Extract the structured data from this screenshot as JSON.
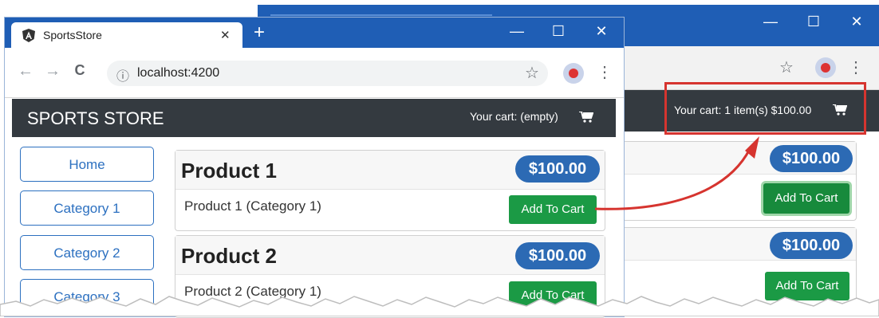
{
  "front": {
    "tab_title": "SportsStore",
    "tab_close": "✕",
    "new_tab": "+",
    "window_controls": {
      "minimize": "—",
      "maximize": "☐",
      "close": "✕"
    },
    "toolbar": {
      "url": "localhost:4200",
      "back": "←",
      "forward": "→",
      "reload": "C",
      "info": "ⓘ",
      "star": "☆",
      "menu": "⋮"
    },
    "navbar": {
      "brand": "SPORTS STORE",
      "cart": "Your cart: (empty)"
    },
    "categories": [
      "Home",
      "Category 1",
      "Category 2",
      "Category 3"
    ],
    "products": [
      {
        "title": "Product 1",
        "price": "$100.00",
        "description": "Product 1 (Category 1)",
        "button": "Add To Cart"
      },
      {
        "title": "Product 2",
        "price": "$100.00",
        "description": "Product 2 (Category 1)",
        "button": "Add To Cart"
      }
    ]
  },
  "back": {
    "window_controls": {
      "minimize": "—",
      "maximize": "☐",
      "close": "✕"
    },
    "toolbar": {
      "star": "☆",
      "menu": "⋮"
    },
    "navbar": {
      "cart": "Your cart: 1 item(s) $100.00"
    },
    "products": [
      {
        "price": "$100.00",
        "button": "Add To Cart"
      },
      {
        "price": "$100.00",
        "button": "Add To Cart"
      }
    ]
  },
  "colors": {
    "accent_blue": "#2c6ab4",
    "add_green": "#1b9a45",
    "navbar": "#343a40",
    "callout_red": "#d6342f",
    "titlebar": "#1f5eb5"
  }
}
